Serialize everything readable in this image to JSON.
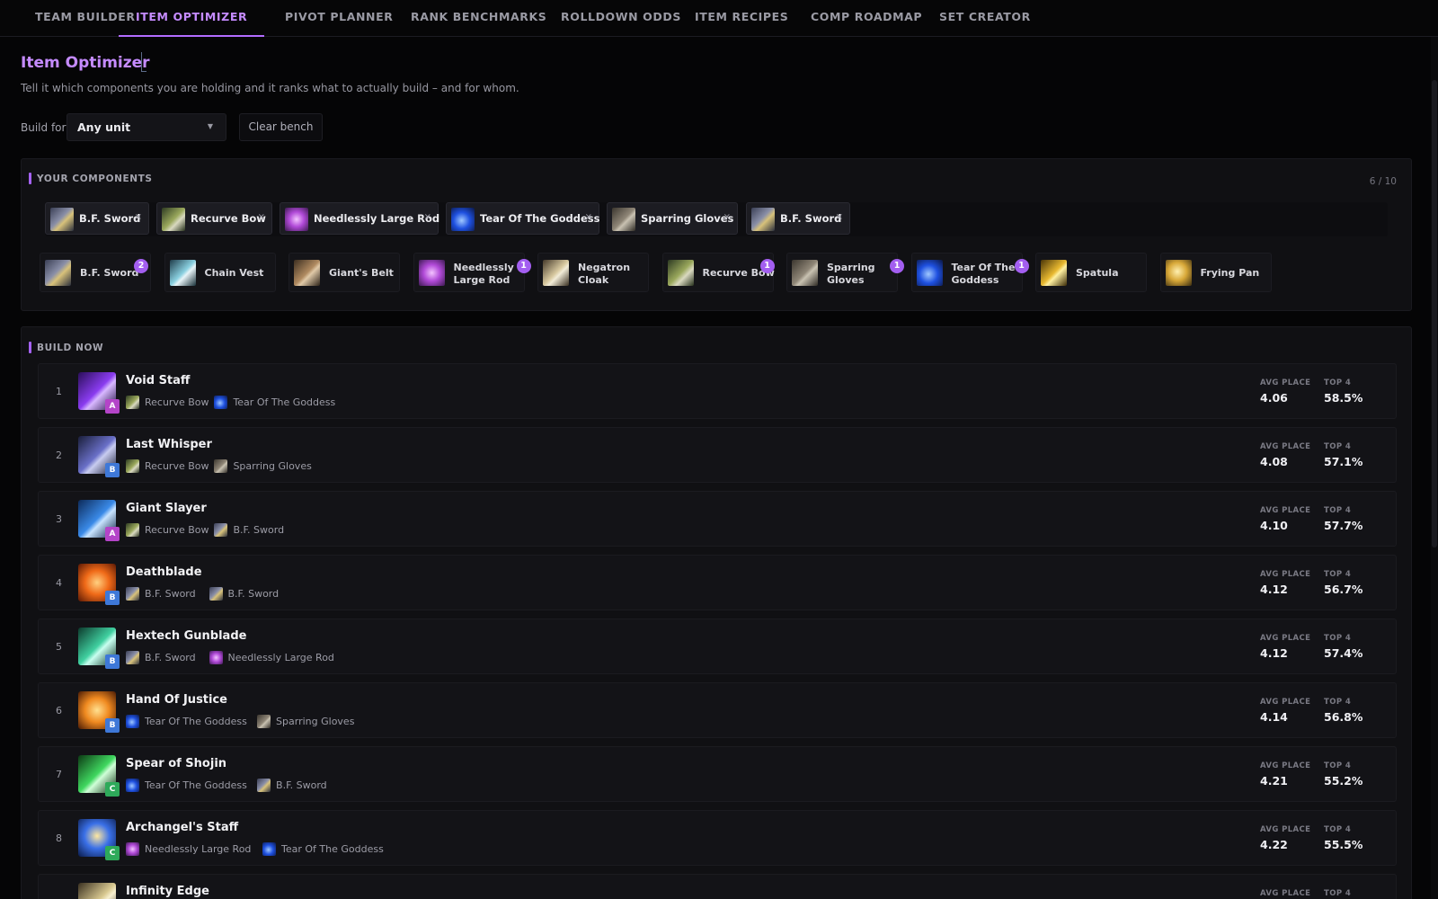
{
  "nav": {
    "tabs": [
      {
        "label": "TEAM BUILDER"
      },
      {
        "label": "ITEM OPTIMIZER"
      },
      {
        "label": "PIVOT PLANNER"
      },
      {
        "label": "RANK BENCHMARKS"
      },
      {
        "label": "ROLLDOWN ODDS"
      },
      {
        "label": "ITEM RECIPES"
      },
      {
        "label": "COMP ROADMAP"
      },
      {
        "label": "SET CREATOR"
      }
    ],
    "active_index": 1
  },
  "page": {
    "title": "Item Optimizer",
    "subtitle": "Tell it which components you are holding and it ranks what to actually build – and for whom."
  },
  "controls": {
    "build_for_label": "Build for",
    "build_for_value": "Any unit",
    "clear_label": "Clear bench"
  },
  "components": {
    "title": "YOUR COMPONENTS",
    "count": "6 / 10",
    "selected": [
      {
        "name": "B.F. Sword",
        "icon": "bf-sword-icon"
      },
      {
        "name": "Recurve Bow",
        "icon": "recurve-bow-icon"
      },
      {
        "name": "Needlessly Large Rod",
        "icon": "large-rod-icon"
      },
      {
        "name": "Tear Of The Goddess",
        "icon": "tear-icon"
      },
      {
        "name": "Sparring Gloves",
        "icon": "gloves-icon"
      },
      {
        "name": "B.F. Sword",
        "icon": "bf-sword-icon"
      }
    ],
    "remove_glyph": "×",
    "bench": [
      {
        "line1": "B.F. Sword",
        "line2": "",
        "badge": "2",
        "icon": "bf-sword-icon"
      },
      {
        "line1": "Chain Vest",
        "line2": "",
        "badge": "",
        "icon": "chain-vest-icon"
      },
      {
        "line1": "Giant's Belt",
        "line2": "",
        "badge": "",
        "icon": "giants-belt-icon"
      },
      {
        "line1": "Needlessly",
        "line2": "Large Rod",
        "badge": "1",
        "icon": "large-rod-icon"
      },
      {
        "line1": "Negatron",
        "line2": "Cloak",
        "badge": "",
        "icon": "negatron-cloak-icon"
      },
      {
        "line1": "Recurve Bow",
        "line2": "",
        "badge": "1",
        "icon": "recurve-bow-icon"
      },
      {
        "line1": "Sparring",
        "line2": "Gloves",
        "badge": "1",
        "icon": "gloves-icon"
      },
      {
        "line1": "Tear Of The",
        "line2": "Goddess",
        "badge": "1",
        "icon": "tear-icon"
      },
      {
        "line1": "Spatula",
        "line2": "",
        "badge": "",
        "icon": "spatula-icon"
      },
      {
        "line1": "Frying Pan",
        "line2": "",
        "badge": "",
        "icon": "frying-pan-icon"
      }
    ]
  },
  "build": {
    "title": "BUILD NOW",
    "avg_label": "AVG PLACE",
    "top4_label": "TOP 4",
    "items": [
      {
        "rank": "1",
        "name": "Void Staff",
        "tier": "A",
        "icon": "void-staff-icon",
        "c1": "Recurve Bow",
        "c1i": "recurve-bow-icon",
        "c2": "Tear Of The Goddess",
        "c2i": "tear-icon",
        "avg": "4.06",
        "top4": "58.5%"
      },
      {
        "rank": "2",
        "name": "Last Whisper",
        "tier": "B",
        "icon": "last-whisper-icon",
        "c1": "Recurve Bow",
        "c1i": "recurve-bow-icon",
        "c2": "Sparring Gloves",
        "c2i": "gloves-icon",
        "avg": "4.08",
        "top4": "57.1%"
      },
      {
        "rank": "3",
        "name": "Giant Slayer",
        "tier": "A",
        "icon": "giant-slayer-icon",
        "c1": "Recurve Bow",
        "c1i": "recurve-bow-icon",
        "c2": "B.F. Sword",
        "c2i": "bf-sword-icon",
        "avg": "4.10",
        "top4": "57.7%"
      },
      {
        "rank": "4",
        "name": "Deathblade",
        "tier": "B",
        "icon": "deathblade-icon",
        "c1": "B.F. Sword",
        "c1i": "bf-sword-icon",
        "c2": "B.F. Sword",
        "c2i": "bf-sword-icon",
        "avg": "4.12",
        "top4": "56.7%"
      },
      {
        "rank": "5",
        "name": "Hextech Gunblade",
        "tier": "B",
        "icon": "gunblade-icon",
        "c1": "B.F. Sword",
        "c1i": "bf-sword-icon",
        "c2": "Needlessly Large Rod",
        "c2i": "large-rod-icon",
        "avg": "4.12",
        "top4": "57.4%"
      },
      {
        "rank": "6",
        "name": "Hand Of Justice",
        "tier": "B",
        "icon": "hand-of-justice-icon",
        "c1": "Tear Of The Goddess",
        "c1i": "tear-icon",
        "c2": "Sparring Gloves",
        "c2i": "gloves-icon",
        "avg": "4.14",
        "top4": "56.8%"
      },
      {
        "rank": "7",
        "name": "Spear of Shojin",
        "tier": "C",
        "icon": "shojin-icon",
        "c1": "Tear Of The Goddess",
        "c1i": "tear-icon",
        "c2": "B.F. Sword",
        "c2i": "bf-sword-icon",
        "avg": "4.21",
        "top4": "55.2%"
      },
      {
        "rank": "8",
        "name": "Archangel's Staff",
        "tier": "C",
        "icon": "archangels-icon",
        "c1": "Needlessly Large Rod",
        "c1i": "large-rod-icon",
        "c2": "Tear Of The Goddess",
        "c2i": "tear-icon",
        "avg": "4.22",
        "top4": "55.5%"
      },
      {
        "rank": "",
        "name": "Infinity Edge",
        "tier": "",
        "icon": "infinity-edge-icon",
        "c1": "",
        "c1i": "",
        "c2": "",
        "c2i": "",
        "avg": "",
        "top4": ""
      }
    ]
  },
  "colors": {
    "accent": "#b26cff",
    "tier_a": "#b444c8",
    "tier_b": "#3e78d8",
    "tier_c": "#2eaa5a"
  }
}
